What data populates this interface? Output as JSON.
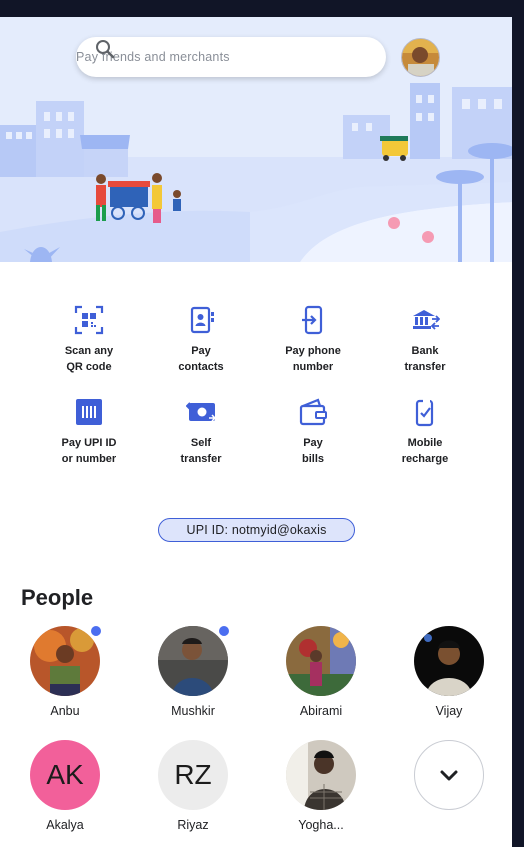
{
  "search": {
    "placeholder": "Pay friends and merchants"
  },
  "icons": {
    "search": "search-icon",
    "profile": "profile-avatar"
  },
  "actions": [
    {
      "label": "Scan any\nQR code",
      "icon": "qr-scan-icon"
    },
    {
      "label": "Pay\ncontacts",
      "icon": "contacts-icon"
    },
    {
      "label": "Pay phone\nnumber",
      "icon": "phone-icon"
    },
    {
      "label": "Bank\ntransfer",
      "icon": "bank-icon"
    },
    {
      "label": "Pay UPI ID\nor number",
      "icon": "upi-icon"
    },
    {
      "label": "Self\ntransfer",
      "icon": "self-transfer-icon"
    },
    {
      "label": "Pay\nbills",
      "icon": "wallet-icon"
    },
    {
      "label": "Mobile\nrecharge",
      "icon": "mobile-recharge-icon"
    }
  ],
  "upi": {
    "label": "UPI ID: notmyid@okaxis"
  },
  "people": {
    "title": "People",
    "contacts": [
      {
        "name": "Anbu",
        "type": "photo",
        "unread": true
      },
      {
        "name": "Mushkir",
        "type": "photo",
        "unread": true
      },
      {
        "name": "Abirami",
        "type": "photo",
        "unread": false
      },
      {
        "name": "Vijay",
        "type": "photo",
        "unread": false
      },
      {
        "name": "Akalya",
        "type": "initials",
        "initials": "AK",
        "color": "#f2609a"
      },
      {
        "name": "Riyaz",
        "type": "initials",
        "initials": "RZ",
        "color": "#ececec"
      },
      {
        "name": "Yogha...",
        "type": "photo",
        "unread": false
      }
    ],
    "more_icon": "chevron-down-icon"
  },
  "colors": {
    "accent": "#3f5fd7",
    "hero_bg": "#dfe8fb",
    "unread_dot": "#4b6ef0"
  }
}
